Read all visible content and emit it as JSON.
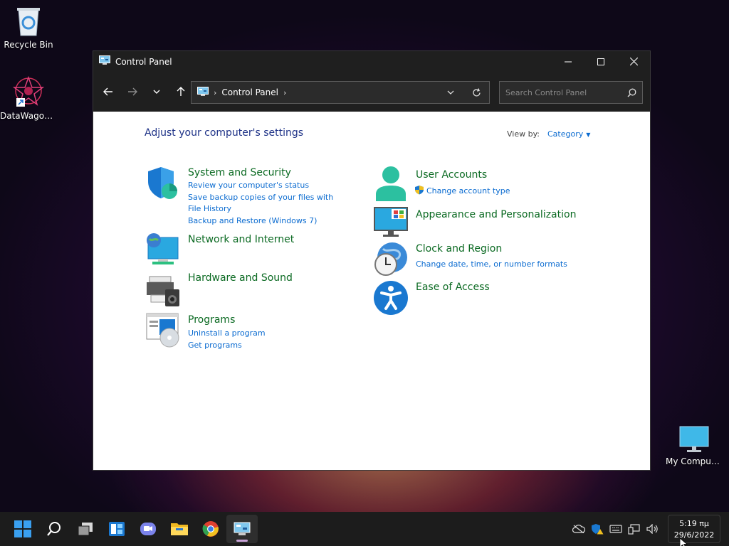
{
  "desktop": {
    "icons": [
      {
        "label": "Recycle Bin"
      },
      {
        "label": "DataWagon..."
      },
      {
        "label": "My Computer"
      }
    ]
  },
  "window": {
    "title": "Control Panel",
    "address": {
      "crumb": "Control Panel"
    },
    "search": {
      "placeholder": "Search Control Panel"
    }
  },
  "content": {
    "heading": "Adjust your computer's settings",
    "view_by_label": "View by:",
    "view_by_value": "Category",
    "categories": [
      {
        "title": "System and Security",
        "links": [
          "Review your computer's status",
          "Save backup copies of your files with File History",
          "Backup and Restore (Windows 7)"
        ]
      },
      {
        "title": "Network and Internet",
        "links": []
      },
      {
        "title": "Hardware and Sound",
        "links": []
      },
      {
        "title": "Programs",
        "links": [
          "Uninstall a program",
          "Get programs"
        ]
      },
      {
        "title": "User Accounts",
        "links": [
          "Change account type"
        ]
      },
      {
        "title": "Appearance and Personalization",
        "links": []
      },
      {
        "title": "Clock and Region",
        "links": [
          "Change date, time, or number formats"
        ]
      },
      {
        "title": "Ease of Access",
        "links": []
      }
    ]
  },
  "taskbar": {
    "clock": {
      "time": "5:19 πμ",
      "date": "29/6/2022"
    }
  },
  "colors": {
    "link": "#0a6bd0",
    "category_title": "#0b6a22",
    "heading": "#1e3287",
    "chrome": "#1f1f1f"
  }
}
